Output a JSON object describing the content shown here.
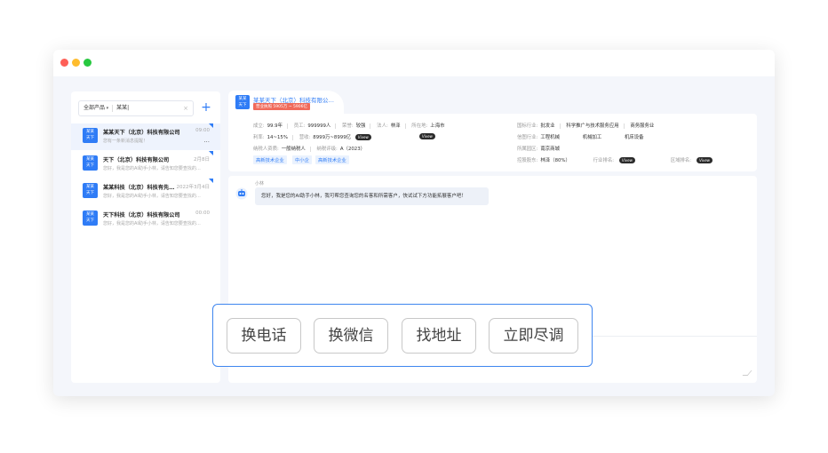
{
  "window": {
    "title_dots": [
      "close",
      "minimize",
      "maximize"
    ]
  },
  "sidebar": {
    "filter_label": "全部产品",
    "search_value": "某某",
    "clear_icon": "×",
    "add_icon": "+",
    "companies": [
      {
        "avatar_line1": "某某",
        "avatar_line2": "天下",
        "name": "某某天下（北京）科技有限公司",
        "time": "09:00",
        "message": "您有一条新消息提醒！",
        "more": "···"
      },
      {
        "avatar_line1": "某某",
        "avatar_line2": "天下",
        "name": "天下（北京）科技有限公司",
        "time": "2月8日",
        "message": "您好，我是您的AI助手小林，请告知您要查找的…",
        "more": ""
      },
      {
        "avatar_line1": "某某",
        "avatar_line2": "天下",
        "name": "某某科技（北京）科技有先…",
        "time": "2022年3月4日",
        "message": "您好，我是您的AI助手小林，请告知您要查找的…",
        "more": ""
      },
      {
        "avatar_line1": "某某",
        "avatar_line2": "天下",
        "name": "天下科技（北京）科技有限公司",
        "time": "00:00",
        "message": "您好，我是您的AI助手小林，请告知您要查找的…",
        "more": ""
      }
    ]
  },
  "header": {
    "avatar_line1": "某某",
    "avatar_line2": "天下",
    "company_name": "某某天下（北京）科技有限公…",
    "badge": "营业执照 5905万 ~ 5906亿"
  },
  "info": {
    "row1": [
      {
        "k": "成立:",
        "v": "99.9年"
      },
      {
        "k": "员工:",
        "v": "999999人"
      },
      {
        "k": "荣誉:",
        "v": "较强"
      },
      {
        "k": "法人:",
        "v": "林泽"
      },
      {
        "k": "所在地:",
        "v": "上海市"
      }
    ],
    "row2": [
      {
        "k": "利率:",
        "v": "14~15%"
      },
      {
        "k": "营收:",
        "v": "8999万~8999亿"
      }
    ],
    "row3": [
      {
        "k": "纳税人资质:",
        "v": "一般纳税人"
      },
      {
        "k": "纳税评级:",
        "v": "A（2023）"
      }
    ],
    "pill_label": "Vivew",
    "industry": {
      "k": "国标行业:",
      "v1": "批发业",
      "v2": "科学推广与技术服务应用",
      "v3": "商务服务业"
    },
    "credit": {
      "k": "信图行业:",
      "v1": "工程机械",
      "v2": "机械加工",
      "v3": "机床设备"
    },
    "park": {
      "k": "所属园区:",
      "v": "南京商城"
    },
    "holder": {
      "k": "控股股东:",
      "v": "林泽（80%）"
    },
    "rank": {
      "k": "行业排名:"
    },
    "region_rank": {
      "k": "区域排名:"
    },
    "tags": [
      "高新技术企业",
      "中小企",
      "高新技术企业"
    ]
  },
  "chat": {
    "bot_name": "小林",
    "bot_icon": "robot-icon",
    "message": "您好，我是您的AI助手小林，我可帮您查询您的名客和所需客户，快试试下方功能拓展客户吧！"
  },
  "quick_actions": [
    "换电话",
    "换微信",
    "找地址",
    "立即尽调"
  ],
  "colors": {
    "accent": "#2f7cf6",
    "badge": "#f06a5a",
    "overlay_border": "#3f86ef"
  }
}
